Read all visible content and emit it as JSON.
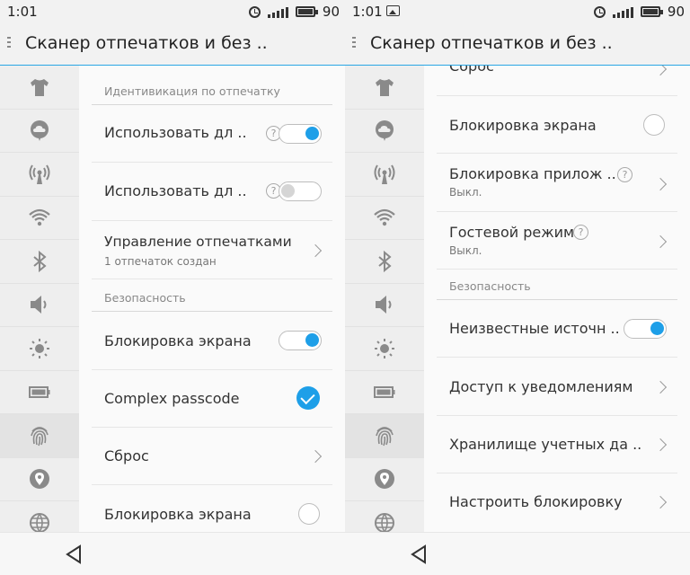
{
  "status": {
    "left_time": "1:01",
    "right_time": "1:01",
    "battery": "90"
  },
  "left": {
    "title": "Сканер отпечатков и без ..",
    "section_fingerprint": "Идентивикация по отпечатку",
    "row_use1": "Использовать дл ..",
    "row_use2": "Использовать дл ..",
    "row_manage": "Управление отпечатками",
    "row_manage_sub": "1 отпечаток создан",
    "section_security": "Безопасность",
    "row_lock": "Блокировка экрана",
    "row_complex": "Complex passcode",
    "row_reset": "Сброс",
    "row_lock2": "Блокировка экрана"
  },
  "right": {
    "title": "Сканер отпечатков и без ..",
    "row_reset_partial": "Сброс",
    "row_lock": "Блокировка экрана",
    "row_applock": "Блокировка прилож ..",
    "row_applock_sub": "Выкл.",
    "row_guest": "Гостевой режим",
    "row_guest_sub": "Выкл.",
    "section_security": "Безопасность",
    "row_unknown": "Неизвестные источн ..",
    "row_notif": "Доступ к уведомлениям",
    "row_creds": "Хранилище учетных да ..",
    "row_setlock": "Настроить блокировку"
  },
  "help_glyph": "?",
  "colors": {
    "accent": "#1e9fe8",
    "header_line": "#2aa6e4"
  },
  "rail_icons": [
    "shirt-icon",
    "cloud-icon",
    "hotspot-icon",
    "wifi-icon",
    "bluetooth-icon",
    "sound-icon",
    "brightness-icon",
    "battery-icon",
    "fingerprint-icon",
    "location-icon",
    "globe-icon"
  ],
  "toggles": {
    "left_use1": true,
    "left_use2": false,
    "left_lock": true,
    "right_unknown": true
  },
  "checks": {
    "left_complex": true,
    "left_lock2": false,
    "right_lock": false
  }
}
